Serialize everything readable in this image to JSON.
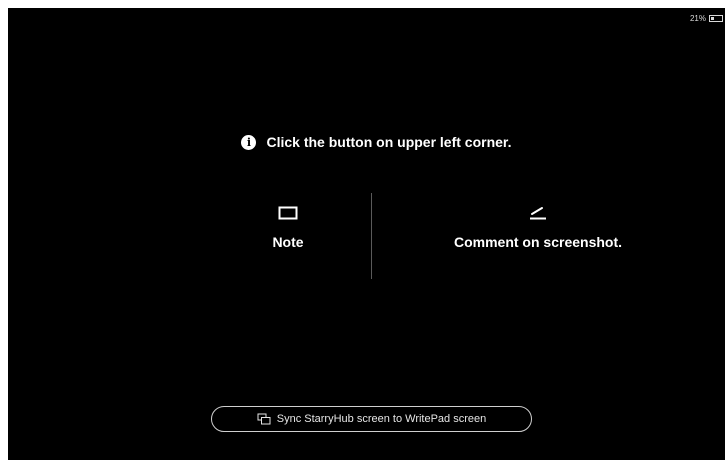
{
  "status": {
    "battery_text": "21%",
    "battery_level": 0.21
  },
  "hint": {
    "icon": "info-icon",
    "text": "Click the button on upper left corner."
  },
  "options": [
    {
      "icon": "rectangle-icon",
      "label": "Note"
    },
    {
      "icon": "pen-line-icon",
      "label": "Comment on screenshot."
    }
  ],
  "sync_button": {
    "icon": "screens-icon",
    "label": "Sync StarryHub screen to WritePad screen"
  },
  "colors": {
    "background": "#000000",
    "foreground": "#ffffff"
  }
}
